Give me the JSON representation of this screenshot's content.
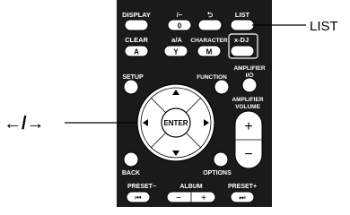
{
  "callouts": {
    "list": "LIST",
    "arrows": "←/→"
  },
  "remote": {
    "row1": {
      "display": "DISPLAY",
      "slash_digit": "/−",
      "zero": "0",
      "back_symbol": "⮌",
      "list": "LIST"
    },
    "row2": {
      "clear": "CLEAR",
      "a_a": "a/A",
      "character": "CHARACTER",
      "xdj": "x-DJ"
    },
    "row2_keys": {
      "a": "A",
      "y": "Y",
      "m": "M"
    },
    "setup": "SETUP",
    "function": "FUNCTION",
    "amplifier": "AMPLIFIER",
    "power_symbol": "I/⏻",
    "enter": "ENTER",
    "amplifier_volume_1": "AMPLIFIER",
    "amplifier_volume_2": "VOLUME",
    "vol_plus": "+",
    "vol_minus": "−",
    "back": "BACK",
    "options": "OPTIONS",
    "preset_minus": "PRESET−",
    "album": "ALBUM",
    "preset_plus": "PRESET+",
    "album_minus": "−",
    "album_plus": "+",
    "prev_symbol": "⏮",
    "next_symbol": "⏭"
  }
}
